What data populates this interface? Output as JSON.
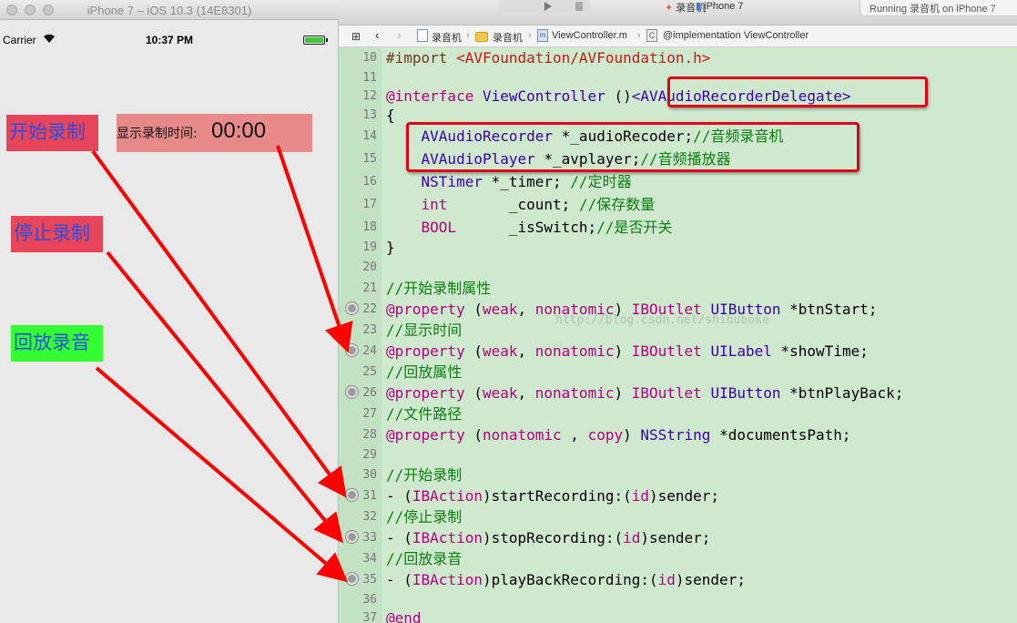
{
  "simulator": {
    "title": "iPhone 7 – iOS 10.3 (14E8301)",
    "status": {
      "carrier": "Carrier",
      "time": "10:37 PM",
      "wifi_icon": "wifi-icon",
      "battery_icon": "battery-icon"
    },
    "buttons": {
      "start": "开始录制",
      "stop": "停止录制",
      "play": "回放录音"
    },
    "time_label": "显示录制时间:",
    "time_value": "00:00",
    "colors": {
      "start_bg": "#e8445a",
      "stop_bg": "#e8445a",
      "play_bg": "#33ff33",
      "time_bg": "#e98a8a",
      "button_text": "#2a4fe0"
    }
  },
  "xcode": {
    "toolbar": {
      "scheme": "录音机",
      "device": "iPhone 7",
      "run_status": "Running 录音机 on iPhone 7"
    },
    "jumpbar": {
      "project": "录音机",
      "group": "录音机",
      "file": "ViewController.m",
      "symbol": "@implementation ViewController"
    },
    "line_numbers": [
      "10",
      "11",
      "12",
      "13",
      "14",
      "15",
      "16",
      "17",
      "18",
      "19",
      "20",
      "21",
      "22",
      "23",
      "24",
      "25",
      "26",
      "27",
      "28",
      "29",
      "30",
      "31",
      "32",
      "33",
      "34",
      "35",
      "36",
      "37"
    ],
    "code": {
      "l10a": "#import ",
      "l10b": "<AVFoundation/AVFoundation.h>",
      "l12a": "@interface",
      "l12b": " ViewController ",
      "l12c": "()",
      "l12d": "<AVAudioRecorderDelegate>",
      "l13": "{",
      "l14a": "    AVAudioRecorder",
      "l14b": " *_audioRecoder;",
      "l14c": "//音频录音机",
      "l15a": "    AVAudioPlayer",
      "l15b": " *_avplayer;",
      "l15c": "//音频播放器",
      "l16a": "    NSTimer",
      "l16b": " *_timer; ",
      "l16c": "//定时器",
      "l17a": "    int",
      "l17b": "       _count; ",
      "l17c": "//保存数量",
      "l18a": "    BOOL",
      "l18b": "      _isSwitch;",
      "l18c": "//是否开关",
      "l19": "}",
      "l21": "//开始录制属性",
      "l22a": "@property",
      "l22b": " (",
      "l22c": "weak",
      "l22d": ", ",
      "l22e": "nonatomic",
      "l22f": ") ",
      "l22g": "IBOutlet",
      "l22h": " ",
      "l22i": "UIButton",
      "l22j": " *btnStart;",
      "l23": "//显示时间",
      "l24a": "@property",
      "l24b": " (",
      "l24c": "weak",
      "l24d": ", ",
      "l24e": "nonatomic",
      "l24f": ") ",
      "l24g": "IBOutlet",
      "l24h": " ",
      "l24i": "UILabel",
      "l24j": " *showTime;",
      "l25": "//回放属性",
      "l26a": "@property",
      "l26b": " (",
      "l26c": "weak",
      "l26d": ", ",
      "l26e": "nonatomic",
      "l26f": ") ",
      "l26g": "IBOutlet",
      "l26h": " ",
      "l26i": "UIButton",
      "l26j": " *btnPlayBack;",
      "l27": "//文件路径",
      "l28a": "@property",
      "l28b": " (",
      "l28c": "nonatomic",
      "l28d": " , ",
      "l28e": "copy",
      "l28f": ") ",
      "l28g": "NSString",
      "l28h": " *documentsPath;",
      "l30": "//开始录制",
      "l31a": "- (",
      "l31b": "IBAction",
      "l31c": ")startRecording:(",
      "l31d": "id",
      "l31e": ")sender;",
      "l32": "//停止录制",
      "l33a": "- (",
      "l33b": "IBAction",
      "l33c": ")stopRecording:(",
      "l33d": "id",
      "l33e": ")sender;",
      "l34": "//回放录音",
      "l35a": "- (",
      "l35b": "IBAction",
      "l35c": ")playBackRecording:(",
      "l35d": "id",
      "l35e": ")sender;",
      "l37": "@end"
    },
    "watermark": "http://blog.csdn.net/shihuboke",
    "colors": {
      "editor_bg": "#cfe9cf",
      "keyword": "#b4007e",
      "type": "#3a00aa",
      "comment": "#0d7d11",
      "string": "#c41a16",
      "annotation": "#e0001a"
    }
  }
}
